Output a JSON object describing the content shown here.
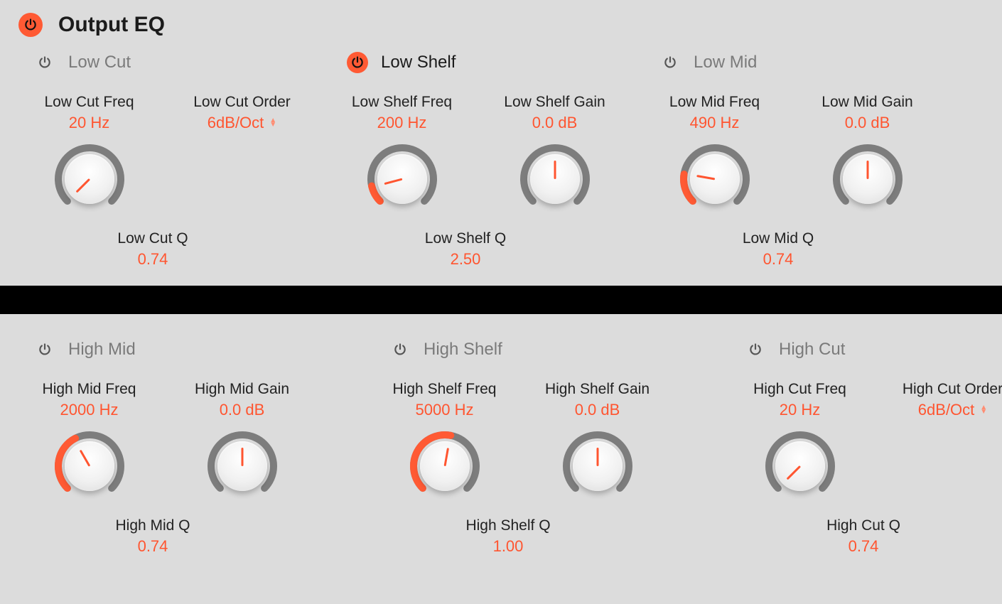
{
  "title": "Output EQ",
  "master_on": true,
  "rows": {
    "top": [
      {
        "id": "low-cut",
        "name": "Low Cut",
        "on": false,
        "params": [
          {
            "label": "Low Cut Freq",
            "value": "20 Hz",
            "kind": "knob",
            "angle": -135,
            "fill": 0.0
          },
          {
            "label": "Low Cut Order",
            "value": "6dB/Oct",
            "kind": "select"
          }
        ],
        "q": {
          "label": "Low Cut Q",
          "value": "0.74"
        }
      },
      {
        "id": "low-shelf",
        "name": "Low Shelf",
        "on": true,
        "params": [
          {
            "label": "Low Shelf Freq",
            "value": "200 Hz",
            "kind": "knob",
            "angle": -105,
            "fill": 0.12
          },
          {
            "label": "Low Shelf Gain",
            "value": "0.0 dB",
            "kind": "knob",
            "angle": 0,
            "fill": 0.0
          }
        ],
        "q": {
          "label": "Low Shelf Q",
          "value": "2.50"
        }
      },
      {
        "id": "low-mid",
        "name": "Low Mid",
        "on": false,
        "params": [
          {
            "label": "Low Mid Freq",
            "value": "490 Hz",
            "kind": "knob",
            "angle": -80,
            "fill": 0.2
          },
          {
            "label": "Low Mid Gain",
            "value": "0.0 dB",
            "kind": "knob",
            "angle": 0,
            "fill": 0.0
          }
        ],
        "q": {
          "label": "Low Mid Q",
          "value": "0.74"
        }
      }
    ],
    "bottom": [
      {
        "id": "high-mid",
        "name": "High Mid",
        "on": false,
        "params": [
          {
            "label": "High Mid Freq",
            "value": "2000 Hz",
            "kind": "knob",
            "angle": -30,
            "fill": 0.4
          },
          {
            "label": "High Mid Gain",
            "value": "0.0 dB",
            "kind": "knob",
            "angle": 0,
            "fill": 0.0
          }
        ],
        "q": {
          "label": "High Mid Q",
          "value": "0.74"
        }
      },
      {
        "id": "high-shelf",
        "name": "High Shelf",
        "on": false,
        "params": [
          {
            "label": "High Shelf Freq",
            "value": "5000 Hz",
            "kind": "knob",
            "angle": 10,
            "fill": 0.54
          },
          {
            "label": "High Shelf Gain",
            "value": "0.0 dB",
            "kind": "knob",
            "angle": 0,
            "fill": 0.0
          }
        ],
        "q": {
          "label": "High Shelf Q",
          "value": "1.00"
        }
      },
      {
        "id": "high-cut",
        "name": "High Cut",
        "on": false,
        "params": [
          {
            "label": "High Cut Freq",
            "value": "20 Hz",
            "kind": "knob",
            "angle": -135,
            "fill": 0.0
          },
          {
            "label": "High Cut Order",
            "value": "6dB/Oct",
            "kind": "select"
          }
        ],
        "q": {
          "label": "High Cut Q",
          "value": "0.74"
        }
      }
    ]
  }
}
